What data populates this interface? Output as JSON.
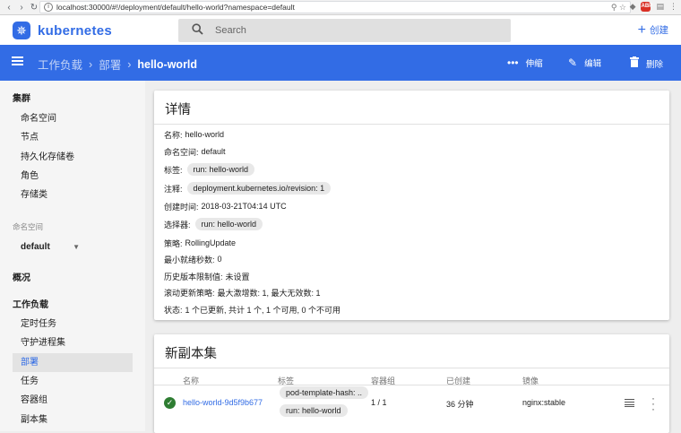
{
  "browser": {
    "url": "localhost:30000/#!/deployment/default/hello-world?namespace=default"
  },
  "topbar": {
    "brand": "kubernetes",
    "search_placeholder": "Search",
    "create_label": "创建"
  },
  "toolbar": {
    "breadcrumbs": [
      "工作负载",
      "部署",
      "hello-world"
    ],
    "scale_label": "伸缩",
    "edit_label": "编辑",
    "delete_label": "删除"
  },
  "sidebar": {
    "cluster_header": "集群",
    "cluster_items": [
      "命名空间",
      "节点",
      "持久化存储卷",
      "角色",
      "存储类"
    ],
    "namespace_label": "命名空间",
    "namespace_value": "default",
    "overview": "概况",
    "workloads_header": "工作负载",
    "workload_items": [
      "定时任务",
      "守护进程集",
      "部署",
      "任务",
      "容器组",
      "副本集"
    ],
    "active_item": "部署"
  },
  "details": {
    "title": "详情",
    "name_key": "名称:",
    "name_val": "hello-world",
    "ns_key": "命名空间:",
    "ns_val": "default",
    "labels_key": "标签:",
    "labels_val": "run: hello-world",
    "annot_key": "注释:",
    "annot_val": "deployment.kubernetes.io/revision: 1",
    "created_key": "创建时间:",
    "created_val": "2018-03-21T04:14 UTC",
    "selector_key": "选择器:",
    "selector_val": "run: hello-world",
    "strategy_key": "策略:",
    "strategy_val": "RollingUpdate",
    "minready_key": "最小就绪秒数:",
    "minready_val": "0",
    "history_key": "历史版本限制值:",
    "history_val": "未设置",
    "rolling_key": "滚动更新策略:",
    "rolling_val": "最大激增数: 1, 最大无效数: 1",
    "status_key": "状态:",
    "status_val": "1 个已更新, 共计 1 个, 1 个可用, 0 个不可用"
  },
  "replicasets": {
    "title": "新副本集",
    "columns": [
      "名称",
      "标签",
      "容器组",
      "已创建",
      "镜像"
    ],
    "row": {
      "name": "hello-world-9d5f9b677",
      "label1": "pod-template-hash: ..",
      "label2": "run: hello-world",
      "pods": "1 / 1",
      "created": "36 分钟",
      "image": "nginx:stable"
    }
  },
  "colors": {
    "brand": "#326ce5",
    "status_ok": "#2e7d32"
  }
}
